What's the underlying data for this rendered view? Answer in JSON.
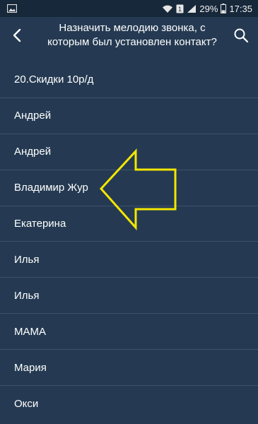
{
  "status_bar": {
    "battery_percent": "29%",
    "time": "17:35",
    "sim_badge": "1",
    "icons": [
      "image-icon",
      "wifi-icon",
      "sim-icon",
      "signal-icon",
      "battery-icon"
    ]
  },
  "header": {
    "title": "Назначить мелодию звонка, с которым был установлен контакт?",
    "icons": [
      "back-arrow-icon",
      "search-icon"
    ]
  },
  "contacts": [
    {
      "name": "20.Скидки 10р/д"
    },
    {
      "name": "Андрей"
    },
    {
      "name": "Андрей"
    },
    {
      "name": "Владимир Жур"
    },
    {
      "name": "Екатерина"
    },
    {
      "name": "Илья"
    },
    {
      "name": "Илья"
    },
    {
      "name": "МАМА"
    },
    {
      "name": "Мария"
    },
    {
      "name": "Окси"
    }
  ],
  "colors": {
    "background": "#253a52",
    "status_bar": "#17283a",
    "divider": "#3e526a",
    "annotation_arrow": "#f3e600",
    "text": "#ffffff"
  }
}
